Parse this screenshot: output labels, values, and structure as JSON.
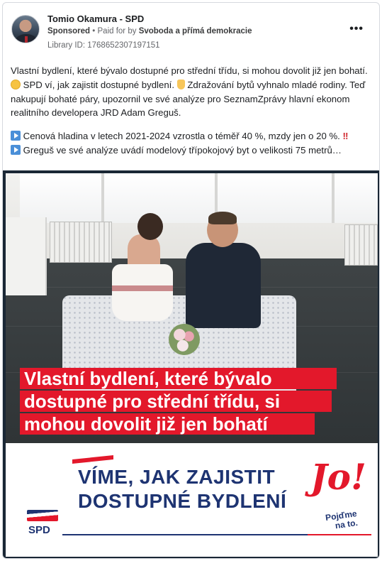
{
  "ad": {
    "page_name": "Tomio Okamura - SPD",
    "sponsored_label": "Sponsored",
    "separator": "•",
    "paid_for_by_label": "Paid for by",
    "payer": "Svoboda a přímá demokracie",
    "library_id": "Library ID: 1768652307197151",
    "more_icon": "more-horizontal-icon"
  },
  "post": {
    "p1_a": "Vlastní bydlení, které bývalo dostupné pro střední třídu, si mohou dovolit již jen bohatí.",
    "p1_b": "SPD ví, jak zajistit dostupné bydlení.",
    "p1_c": "Zdražování bytů vyhnalo mladé rodiny. Teď nakupují bohaté páry, upozornil ve své analýze pro SeznamZprávy hlavní ekonom realitního developera JRD Adam Greguš.",
    "p2": "Cenová hladina v letech 2021-2024 vzrostla o téměř 40 %, mzdy jen o 20 %.",
    "p2_bang": "‼",
    "p3": "Greguš ve své analýze uvádí modelový třípokojový byt o velikosti 75 metrů…"
  },
  "image": {
    "caption_lines": [
      "Vlastní bydlení, které bývalo",
      "dostupné pro střední třídu, si",
      "mohou dovolit již jen bohatí"
    ],
    "banner_line1": "VÍME, JAK ZAJISTIT",
    "banner_line2": "DOSTUPNÉ BYDLENÍ",
    "jo_text": "Jo!",
    "pojdme_text_1": "Pojďme",
    "pojdme_text_2": "na to.",
    "spd_logo_text": "SPD"
  },
  "colors": {
    "accent_red": "#e3182b",
    "brand_blue": "#1e3472"
  }
}
